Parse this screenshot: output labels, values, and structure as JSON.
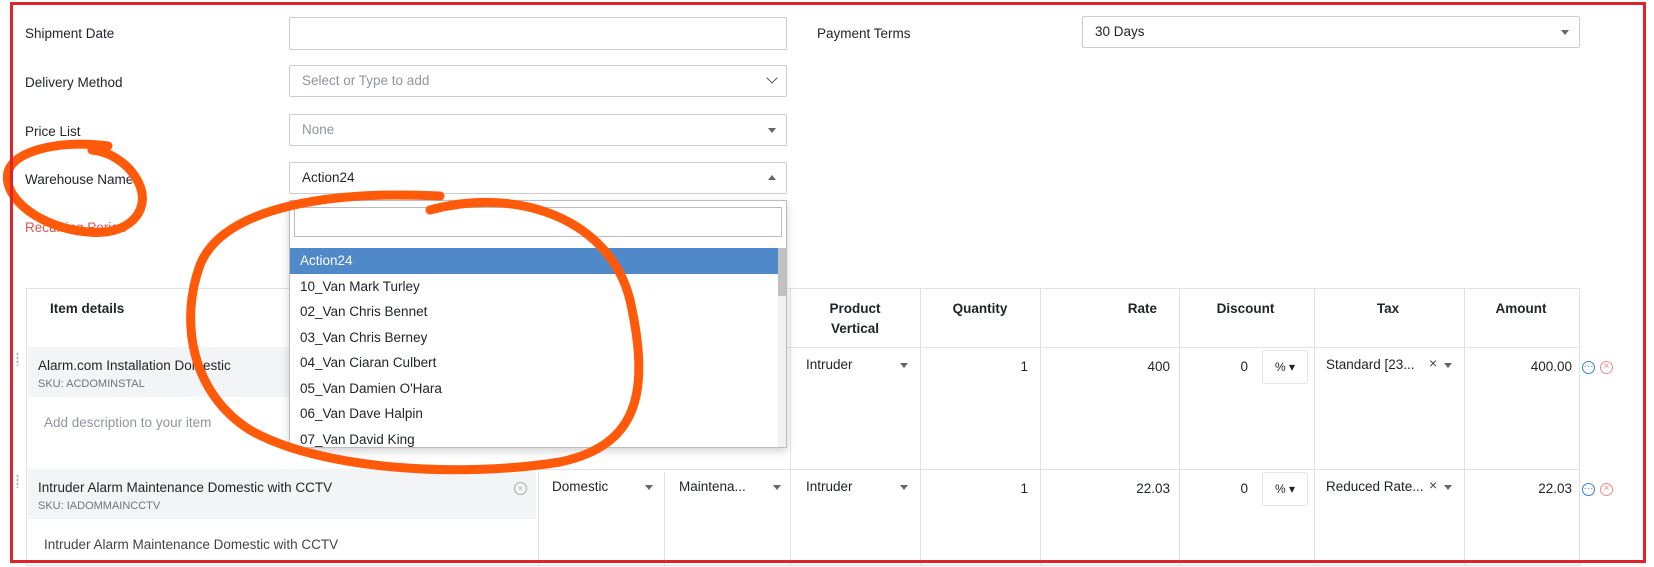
{
  "form": {
    "shipment_date_label": "Shipment Date",
    "shipment_date_value": "",
    "payment_terms_label": "Payment Terms",
    "payment_terms_value": "30 Days",
    "delivery_method_label": "Delivery Method",
    "delivery_method_placeholder": "Select or Type to add",
    "price_list_label": "Price List",
    "price_list_value": "None",
    "warehouse_label": "Warehouse Name",
    "warehouse_value": "Action24",
    "recurring_label": "Recurring Period"
  },
  "dropdown": {
    "search_value": "",
    "options": [
      "Action24",
      "10_Van Mark Turley",
      "02_Van Chris Bennet",
      "03_Van Chris Berney",
      "04_Van Ciaran Culbert",
      "05_Van Damien O'Hara",
      "06_Van Dave Halpin",
      "07_Van David King"
    ],
    "selected": "Action24"
  },
  "table": {
    "headers": {
      "item_details": "Item details",
      "product_vertical_line1": "Product",
      "product_vertical_line2": "Vertical",
      "quantity": "Quantity",
      "rate": "Rate",
      "discount": "Discount",
      "tax": "Tax",
      "amount": "Amount"
    },
    "rows": [
      {
        "name": "Alarm.com Installation Domestic",
        "sku": "SKU: ACDOMINSTAL",
        "description": "Add description to your item",
        "col_a": "",
        "col_b": "",
        "vertical": "Intruder",
        "quantity": "1",
        "rate": "400",
        "discount": "0",
        "discount_unit": "%",
        "tax": "Standard [23...",
        "amount": "400.00"
      },
      {
        "name": "Intruder Alarm Maintenance Domestic with CCTV",
        "sku": "SKU: IADOMMAINCCTV",
        "description": "Intruder Alarm Maintenance Domestic with CCTV",
        "col_a": "Domestic",
        "col_b": "Maintena...",
        "vertical": "Intruder",
        "quantity": "1",
        "rate": "22.03",
        "discount": "0",
        "discount_unit": "%",
        "tax": "Reduced Rate...",
        "amount": "22.03"
      }
    ]
  },
  "colors": {
    "selected_option": "#5089c9",
    "annotation": "#ff5a0a",
    "frame": "#e0232b",
    "error_label": "#d9534f"
  }
}
